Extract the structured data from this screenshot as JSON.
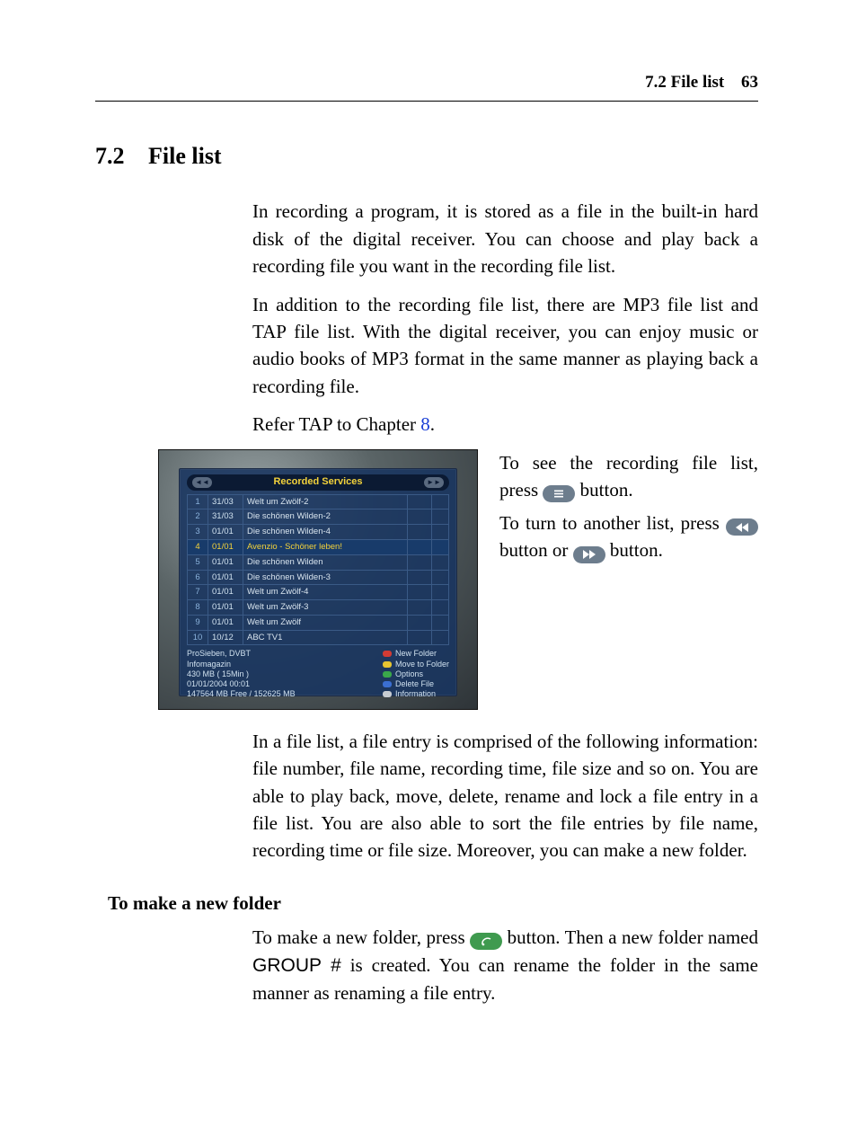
{
  "header": {
    "section_ref": "7.2 File list",
    "page_number": "63"
  },
  "section": {
    "number": "7.2",
    "title": "File list"
  },
  "paragraphs": {
    "p1": "In recording a program, it is stored as a file in the built-in hard disk of the digital receiver. You can choose and play back a recording file you want in the recording file list.",
    "p2": "In addition to the recording file list, there are MP3 file list and TAP file list. With the digital receiver, you can enjoy music or audio books of MP3 format in the same manner as playing back a recording file.",
    "p3_a": "Refer TAP to Chapter ",
    "p3_link": "8",
    "p3_b": ".",
    "side1_a": "To see the recording file list, press ",
    "side1_b": " button.",
    "side2_a": "To turn to another list, press ",
    "side2_b": " button or ",
    "side2_c": " button.",
    "p4": "In a file list, a file entry is comprised of the following information: file number, file name, recording time, file size and so on. You are able to play back, move, delete, rename and lock a file entry in a file list. You are also able to sort the file entries by file name, recording time or file size. Moreover, you can make a new folder.",
    "sub_title": "To make a new folder",
    "p5_a": "To make a new folder, press ",
    "p5_b": " button. Then a new folder named ",
    "p5_group": "GROUP #",
    "p5_c": " is created. You can rename the folder in the same manner as renaming a file entry."
  },
  "screenshot": {
    "title": "Recorded Services",
    "nav_left": "◄◄",
    "nav_right": "►►",
    "rows": [
      {
        "n": "1",
        "d": "31/03",
        "t": "Welt um Zwölf-2"
      },
      {
        "n": "2",
        "d": "31/03",
        "t": "Die schönen Wilden-2"
      },
      {
        "n": "3",
        "d": "01/01",
        "t": "Die schönen Wilden-4"
      },
      {
        "n": "4",
        "d": "01/01",
        "t": "Avenzio - Schöner leben!"
      },
      {
        "n": "5",
        "d": "01/01",
        "t": "Die schönen Wilden"
      },
      {
        "n": "6",
        "d": "01/01",
        "t": "Die schönen Wilden-3"
      },
      {
        "n": "7",
        "d": "01/01",
        "t": "Welt um Zwölf-4"
      },
      {
        "n": "8",
        "d": "01/01",
        "t": "Welt um Zwölf-3"
      },
      {
        "n": "9",
        "d": "01/01",
        "t": "Welt um Zwölf"
      },
      {
        "n": "10",
        "d": "10/12",
        "t": "ABC TV1"
      }
    ],
    "selected_index": 3,
    "meta": [
      "ProSieben, DVBT",
      "Infomagazin",
      "430 MB ( 15Min )",
      "01/01/2004 00:01",
      "147564 MB Free / 152625 MB"
    ],
    "legend": [
      {
        "c": "r",
        "t": "New Folder"
      },
      {
        "c": "y",
        "t": "Move to Folder"
      },
      {
        "c": "g",
        "t": "Options"
      },
      {
        "c": "b",
        "t": "Delete File"
      },
      {
        "c": "w",
        "t": "Information"
      }
    ]
  },
  "icons": {
    "list_button": "list-icon",
    "rew_button": "rewind-icon",
    "ffwd_button": "fast-forward-icon",
    "sat_button": "sat-icon"
  }
}
